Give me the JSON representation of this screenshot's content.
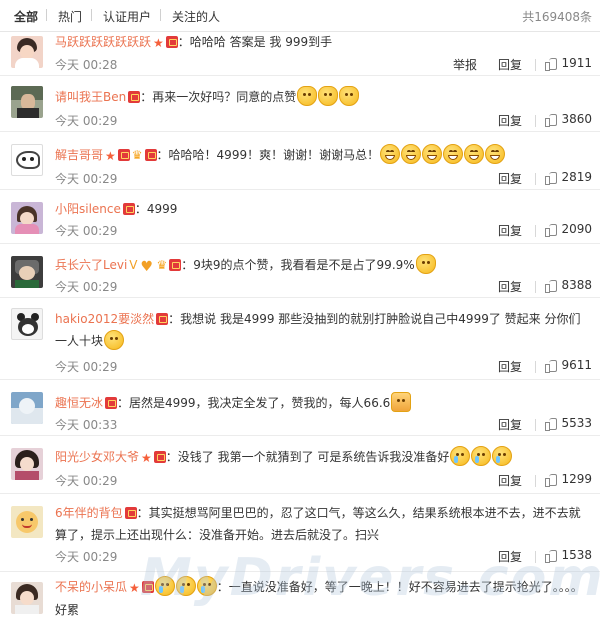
{
  "tabs": [
    {
      "label": "全部"
    },
    {
      "label": "热门"
    },
    {
      "label": "认证用户"
    },
    {
      "label": "关注的人"
    }
  ],
  "total_count": "共169408条",
  "actions": {
    "report": "举报",
    "reply": "回复"
  },
  "comments": [
    {
      "user": "马跃跃跃跃跃跃跃",
      "text": "：哈哈哈 答案是 我 999到手",
      "time": "今天 00:28",
      "likes": "1911"
    },
    {
      "user": "请叫我王Ben",
      "text": "：再来一次好吗？同意的点赞",
      "time": "今天 00:29",
      "likes": "3860"
    },
    {
      "user": "解吉哥哥",
      "text": "：哈哈哈！4999！爽！谢谢！谢谢马总！",
      "time": "今天 00:29",
      "likes": "2819"
    },
    {
      "user": "小阳silence",
      "text": "：4999",
      "time": "今天 00:29",
      "likes": "2090"
    },
    {
      "user": "兵长六了Levi",
      "text": "：9块9的点个赞，我看看是不是占了99.9%",
      "time": "今天 00:29",
      "likes": "8388"
    },
    {
      "user": "hakio2012要淡然",
      "text": "：我想说 我是4999 那些没抽到的就别打肿脸说自己中4999了 赞起来 分你们一人十块",
      "time": "今天 00:29",
      "likes": "9611"
    },
    {
      "user": "趣恒无冰",
      "text": "：居然是4999，我决定全发了，赞我的，每人66.6",
      "time": "今天 00:33",
      "likes": "5533"
    },
    {
      "user": "阳光少女邓大爷",
      "text": "：没钱了 我第一个就猜到了 可是系统告诉我没准备好",
      "time": "今天 00:29",
      "likes": "1299"
    },
    {
      "user": "6年伴的背包",
      "text": "：其实挺想骂阿里巴巴的，忍了这口气，等这么久，结果系统根本进不去，进不去就算了，提示上还出现什么：没准备开始。进去后就没了。扫兴",
      "time": "今天 00:29",
      "likes": "1538"
    },
    {
      "user": "不呆的小呆瓜",
      "text": "：一直说没准备好，等了一晚上！！好不容易进去了提示抢光了。。。。好累",
      "time": "",
      "likes": ""
    }
  ],
  "watermark": "MyDrivers.com",
  "colors": {
    "username": "#eb7350",
    "badge": "#e23a3a",
    "text": "#333333",
    "meta": "#888888"
  }
}
